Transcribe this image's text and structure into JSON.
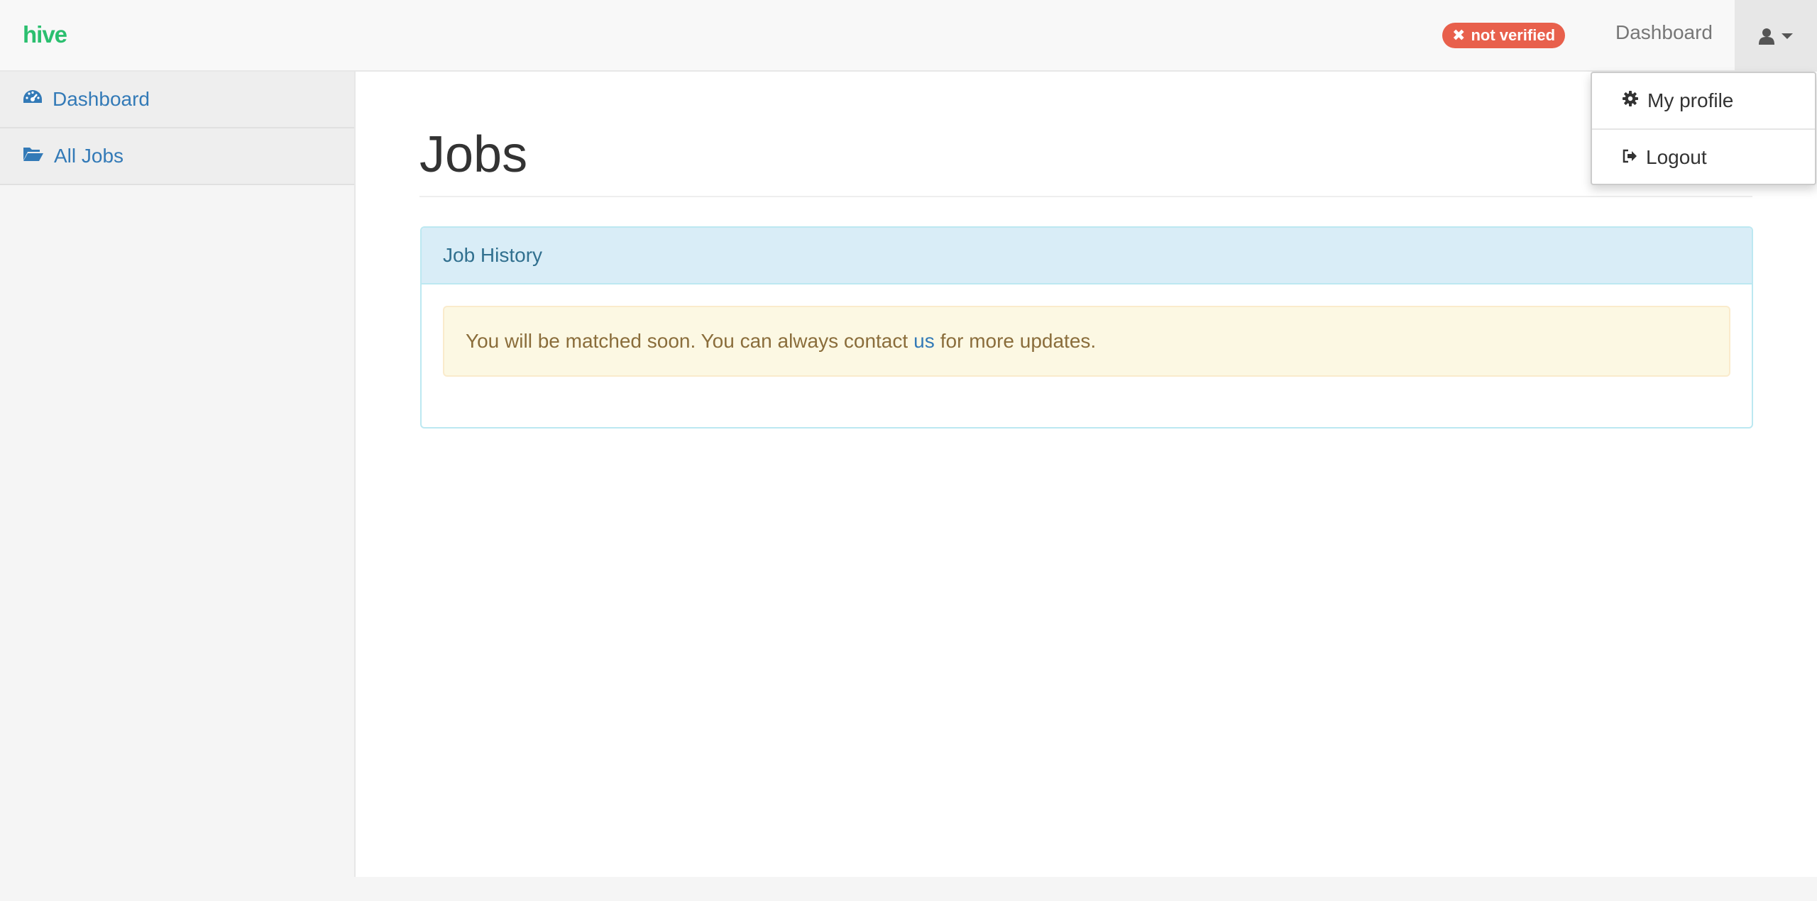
{
  "navbar": {
    "brand": "hive",
    "status_badge": "not verified",
    "dashboard_link": "Dashboard"
  },
  "sidebar": {
    "items": [
      {
        "label": "Dashboard",
        "icon": "dashboard-icon"
      },
      {
        "label": "All Jobs",
        "icon": "folder-open-icon"
      }
    ]
  },
  "main": {
    "title": "Jobs",
    "panel": {
      "heading": "Job History",
      "alert": {
        "text_before": "You will be matched soon. You can always contact",
        "link_text": "us",
        "text_after": "for more updates."
      }
    }
  },
  "user_menu": {
    "items": [
      {
        "label": "My profile",
        "icon": "gear-icon"
      },
      {
        "label": "Logout",
        "icon": "sign-out-icon"
      }
    ]
  },
  "colors": {
    "brand": "#2bbf6f",
    "badge": "#e8604c",
    "link": "#337ab7",
    "panel_heading_bg": "#d9edf7",
    "alert_bg": "#fcf8e3"
  }
}
